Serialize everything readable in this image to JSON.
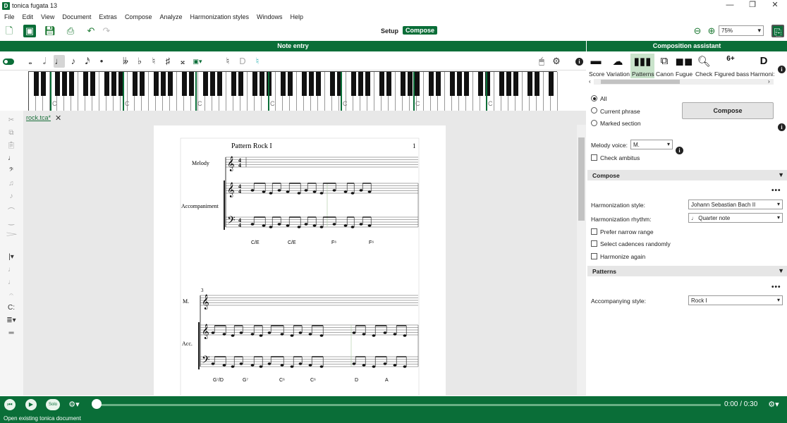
{
  "window": {
    "title": "tonica fugata 13",
    "app_icon": "D",
    "min": "—",
    "max": "❐",
    "close": "✕"
  },
  "menu": [
    "File",
    "Edit",
    "View",
    "Document",
    "Extras",
    "Compose",
    "Analyze",
    "Harmonization styles",
    "Windows",
    "Help"
  ],
  "toolbar": {
    "mode_setup": "Setup",
    "mode_compose": "Compose",
    "zoom": "75%"
  },
  "note_entry": {
    "title": "Note entry"
  },
  "keyboard_labels": [
    "C",
    "C",
    "C",
    "C",
    "C",
    "C",
    "C"
  ],
  "document": {
    "tab": "rock.tca*"
  },
  "score": {
    "title": "Pattern Rock I",
    "page_number": "1",
    "system1": {
      "staff_labels": [
        "Melody",
        "Accompaniment"
      ],
      "time_signature": "4/4",
      "chords": [
        "C/E",
        "C/E",
        "F⁶",
        "F⁶"
      ]
    },
    "system2": {
      "measure_number": "3",
      "staff_labels": [
        "M.",
        "Acc."
      ],
      "chords": [
        "G⁷/D",
        "G⁷",
        "C⁶",
        "C⁶",
        "D",
        "A"
      ]
    }
  },
  "assistant": {
    "title": "Composition assistant",
    "modes": [
      {
        "name": "Score",
        "icon": "score-icon"
      },
      {
        "name": "Variation",
        "icon": "variation-icon"
      },
      {
        "name": "Patterns",
        "icon": "patterns-icon"
      },
      {
        "name": "Canon",
        "icon": "canon-icon"
      },
      {
        "name": "Fugue",
        "icon": "fugue-icon"
      },
      {
        "name": "Check",
        "icon": "check-icon"
      },
      {
        "name": "Figured bass",
        "icon": "figured-bass-icon",
        "glyph": "6+"
      },
      {
        "name": "Harmoni:",
        "icon": "harmonization-icon",
        "glyph": "D"
      }
    ],
    "scope": {
      "all": "All",
      "current_phrase": "Current phrase",
      "marked_section": "Marked section"
    },
    "compose_button": "Compose",
    "melody_voice_label": "Melody voice:",
    "melody_voice_value": "M.",
    "check_ambitus": "Check ambitus",
    "section_compose": "Compose",
    "harmonization_style_label": "Harmonization style:",
    "harmonization_style_value": "Johann Sebastian Bach II",
    "harmonization_rhythm_label": "Harmonization rhythm:",
    "harmonization_rhythm_value": "♩ Quarter note",
    "prefer_narrow_range": "Prefer narrow range",
    "select_cadences_randomly": "Select cadences randomly",
    "harmonize_again": "Harmonize again",
    "section_patterns": "Patterns",
    "accompanying_style_label": "Accompanying style:",
    "accompanying_style_value": "Rock I",
    "more": "•••"
  },
  "playback": {
    "time": "0:00 / 0:30",
    "solo": "Solo"
  },
  "status": {
    "text": "Open existing tonica document"
  },
  "colors": {
    "accent": "#0a6e38",
    "selected_mode": "#c9e3cb"
  }
}
